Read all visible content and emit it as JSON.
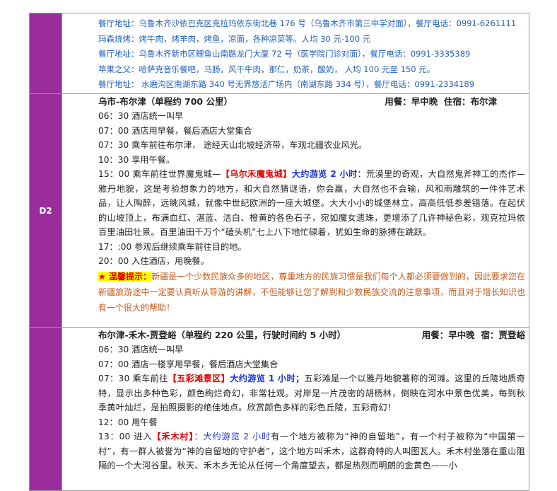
{
  "row1": {
    "lines": [
      "餐厅地址：乌鲁木齐沙依巴克区克拉玛依东街北巷 176 号（乌鲁木齐市第三中学对面），餐厅电话：0991-6261111",
      "玛森烧烤：烤牛肉，烤羊肉，烤鱼，凉面，各种凉菜等。人均 30 元-100 元",
      "餐厅地址：乌鲁木齐新市区鲤鱼山南路龙门大厦 72 号（医学院门诊对面），餐厅电话：0991-3335389",
      "苹果之父：哈萨克音乐餐吧，马肠，风干牛肉，那仁，奶茶，酸奶，  人均 100 元至 150 元。",
      "餐厅地址：  水磨沟区南湖东路 340 号无界悠活广场内（南湖东路 334 号），餐厅电话：0991-2334189"
    ]
  },
  "row2": {
    "day": "D2",
    "route": "乌市-布尔津（单程约 700 公里）",
    "meals": "用餐：早中晚",
    "stay": "住宿：布尔津",
    "t1": "06：30  酒店统一叫早",
    "t2": "07：00  酒店用早餐，餐后酒店大堂集合",
    "t3": "07：30 乘车前往布尔津，  途经天山北坡经济带，车观北疆农业风光。",
    "t4": "10：30  享用午餐。",
    "t5_pre": "15：00 乘车前往世界魔鬼城—",
    "t5_red": "【乌尔禾魔鬼城】",
    "t5_blue": "大约游览 2 小时",
    "t5_rest": "：荒漠里的奇观，大自然鬼斧神工的杰作—雅丹地貌，这是考验想象力的地方，和大自然猜谜语，你会赢，大自然也不会输，风和雨雕筑的一件件艺术品，让人陶醉，远眺风城，就像中世纪欧洲的一座大城堡。大大小小的城堡林立，高高低低参差错落。在起伏的山坡顶上，布满血红、湛蓝、洁白、橙黄的各色石子，宛如魔女遗珠，更增添了几许神秘色彩，观克拉玛依百里油田壮景。百里油田千万个“磕头机”七上八下地忙碌着，犹如生命的脉搏在跳跃。",
    "t6": "17：:00 参观后继续乘车前往目的地。",
    "t7": "20：00 入住酒店，用晚餐。",
    "tip_label": "★ 温馨提示：",
    "tip_text": "新疆是一个少数民族众多的地区，尊重地方的民族习惯是我们每个人都必须要做到的，因此要求您在新疆旅游途中一定要认真听从导游的讲解，不但能够让您了解到和少数民族交流的注意事项，而且对于增长知识也有一个很大的帮助！"
  },
  "row3": {
    "route": "布尔津-禾木-贾登峪（单程约 220 公里，行驶时间约 5 小时）",
    "meals": "用餐：早中晚",
    "stay": "宿：贾登峪",
    "t1": "06：30  酒店统一叫早",
    "t2": "07：00  酒店一楼享用早餐，餐后酒店大堂集合",
    "t3_pre": "07：30 乘车前往",
    "t3_red": "【五彩滩景区】",
    "t3_blue": "大约游览 1 小时；",
    "t3_rest": "五彩滩是一个以雅丹地貌著称的河滩。这里的丘陵地质奇特，显示出多种色彩，颜色绚烂奇幻，非常壮观。对岸是一片茂密的胡杨林，倒映在河水中景色优美，每到秋季黄叶灿烂，是拍照摄影的绝佳地点。欣赏颜色多样的彩色丘陵，五彩奇幻！",
    "t4": "12：00    用午餐",
    "t5_pre": "13：00 进入",
    "t5_red": "【禾木村】",
    "t5_blue": "：大约游览 2 小时",
    "t5_rest": "有一个地方被称为“神的自留地”，有一个村子被称为“中国第一村”，有一群人被誉为“神的自留地的守护者”，这个地方叫禾木，这群奇特的人叫图瓦人。禾木村坐落在重山阻隔的一个大河谷里。秋天、禾木乡无论从任何一个角度望去，都是热烈而明朗的金黄色——小"
  }
}
